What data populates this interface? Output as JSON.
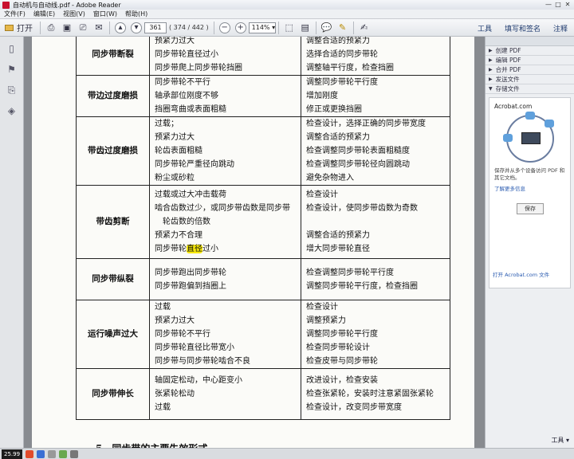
{
  "window": {
    "title": "自动机与自动线.pdf - Adobe Reader",
    "controls": [
      "—",
      "□",
      "✕"
    ]
  },
  "menu": [
    "文件(F)",
    "编辑(E)",
    "视图(V)",
    "窗口(W)",
    "帮助(H)"
  ],
  "toolbar": {
    "open_label": "打开",
    "page_current": "361",
    "page_total": "( 374 / 442 )",
    "zoom": "114%",
    "right_tabs": [
      "工具",
      "填写和签名",
      "注释"
    ]
  },
  "right_panel": {
    "items": [
      "创建 PDF",
      "编辑 PDF",
      "合并 PDF",
      "发送文件",
      "存储文件"
    ],
    "box_title": "Acrobat.com",
    "box_desc": "保存并从多个设备访问 PDF 和其它文档。",
    "learn_more": "了解更多信息",
    "save_label": "保存",
    "open_link": "打开 Acrobat.com 文件",
    "tools_label": "工具 ▾"
  },
  "table": {
    "rows": [
      {
        "fault": "同步带断裂",
        "causes": [
          "预紧力过大",
          "同步带轮直径过小",
          "同步带爬上同步带轮挡圈"
        ],
        "fixes": [
          "调整合适的预紧力",
          "选择合适的同步带轮",
          "调整轴平行度，检查挡圈"
        ]
      },
      {
        "fault": "带边过度磨损",
        "causes": [
          "同步带轮不平行",
          "轴承部位刚度不够",
          "挡圈弯曲或表面粗糙"
        ],
        "fixes": [
          "调整同步带轮平行度",
          "增加刚度",
          "修正或更换挡圈"
        ]
      },
      {
        "fault": "带齿过度磨损",
        "causes": [
          "过载；",
          "预紧力过大",
          "轮齿表面粗糙",
          "同步带轮严重径向跳动",
          "粉尘或砂粒"
        ],
        "fixes": [
          "检查设计，选择正确的同步带宽度",
          "调整合适的预紧力",
          "检查调整同步带轮表面粗糙度",
          "检查调整同步带轮径向圆跳动",
          "避免杂物进入"
        ]
      },
      {
        "fault": "带齿剪断",
        "causes": [
          "过载或过大冲击载荷",
          "啮合齿数过少，或同步带齿数是同步带",
          "　轮齿数的倍数",
          "预紧力不合理",
          "同步带轮直径过小"
        ],
        "fixes": [
          "检查设计",
          "检查设计，使同步带齿数为奇数",
          "",
          "调整合适的预紧力",
          "增大同步带轮直径"
        ]
      },
      {
        "fault": "同步带纵裂",
        "causes": [
          "同步带跑出同步带轮",
          "同步带跑偏到挡圈上"
        ],
        "fixes": [
          "检查调整同步带轮平行度",
          "调整同步带轮平行度，检查挡圈"
        ]
      },
      {
        "fault": "运行噪声过大",
        "causes": [
          "过载",
          "预紧力过大",
          "同步带轮不平行",
          "同步带轮直径比带宽小",
          "同步带与同步带轮啮合不良"
        ],
        "fixes": [
          "检查设计",
          "调整预紧力",
          "调整同步带轮平行度",
          "检查同步带轮设计",
          "检查皮带与同步带轮"
        ]
      },
      {
        "fault": "同步带伸长",
        "causes": [
          "轴固定松动，中心距变小",
          "张紧轮松动",
          "过载"
        ],
        "fixes": [
          "改进设计，检查安装",
          "检查张紧轮，安装时注意紧固张紧轮",
          "检查设计，改变同步带宽度"
        ]
      }
    ],
    "highlight": "直径"
  },
  "section_heading": "5　同步带的主要失效形式",
  "status": {
    "coord": "25.99"
  },
  "colors": {
    "highlight": "#f8ea0a",
    "adobe_red": "#c8102e",
    "link": "#2a5bb0"
  }
}
